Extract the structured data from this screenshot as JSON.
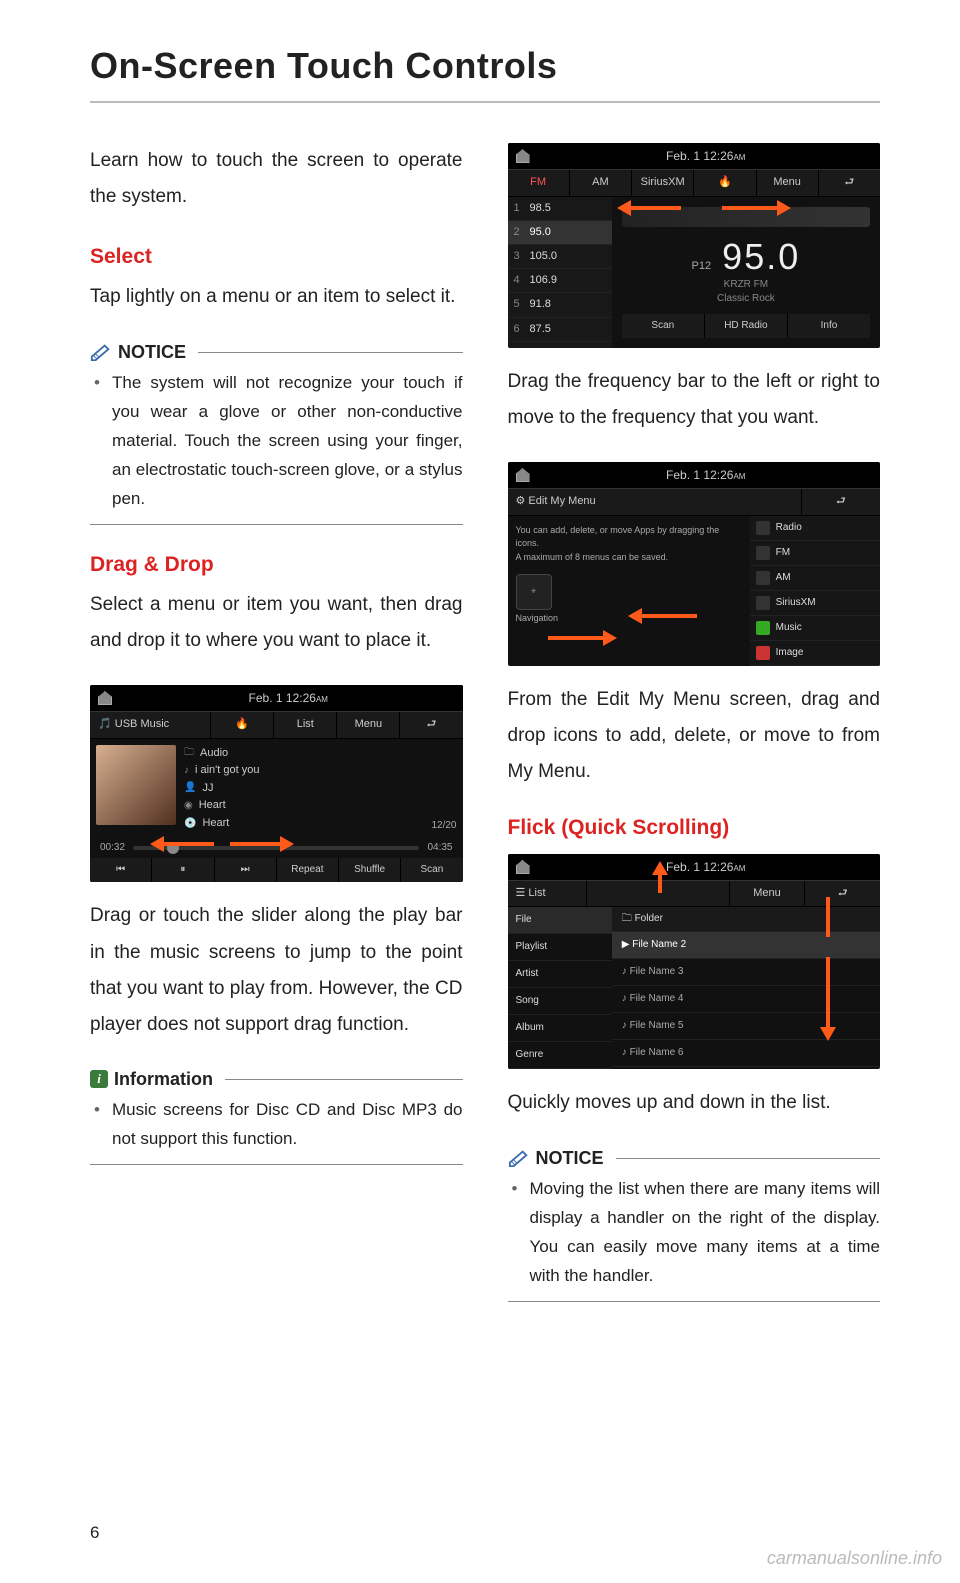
{
  "page": {
    "title": "On-Screen Touch Controls",
    "number": "6",
    "watermark": "carmanualsonline.info"
  },
  "left": {
    "intro": "Learn how to touch the screen to operate the system.",
    "select": {
      "heading": "Select",
      "body": "Tap lightly on a menu or an item to select it."
    },
    "notice1": {
      "label": "NOTICE",
      "body": "The system will not recognize your touch if you wear a glove or other non-conductive material. Touch the screen using your finger, an electrostatic touch-screen glove, or a stylus pen."
    },
    "dragdrop": {
      "heading": "Drag & Drop",
      "body": "Select a menu or item you want, then drag and drop it to where you want to place it."
    },
    "usb_shot": {
      "time": "Feb. 1   12:26",
      "time_suffix": "AM",
      "source": "USB Music",
      "list_btn": "List",
      "menu_btn": "Menu",
      "folder": "Audio",
      "track": "i ain't got you",
      "artist": "JJ",
      "album1": "Heart",
      "album2": "Heart",
      "counter": "12/20",
      "t_cur": "00:32",
      "t_tot": "04:35",
      "foot": [
        "⏮",
        "⏸",
        "⏭",
        "Repeat",
        "Shuffle",
        "Scan"
      ]
    },
    "dragdrop_caption": "Drag or touch the slider along the play bar in the music screens to jump to the point that you want to play from. However, the CD player does not support drag function.",
    "information": {
      "label": "Information",
      "body": "Music screens for Disc CD and Disc MP3 do not support this function."
    }
  },
  "right": {
    "radio_shot": {
      "time": "Feb. 1   12:26",
      "time_suffix": "AM",
      "tabs": [
        "FM",
        "AM",
        "SiriusXM"
      ],
      "menu_btn": "Menu",
      "presets": [
        {
          "n": "1",
          "v": "98.5"
        },
        {
          "n": "2",
          "v": "95.0"
        },
        {
          "n": "3",
          "v": "105.0"
        },
        {
          "n": "4",
          "v": "106.9"
        },
        {
          "n": "5",
          "v": "91.8"
        },
        {
          "n": "6",
          "v": "87.5"
        }
      ],
      "preset_label": "P12",
      "big_freq": "95.0",
      "station": "KRZR FM",
      "genre": "Classic Rock",
      "foot": [
        "Scan",
        "HD Radio",
        "Info"
      ]
    },
    "radio_caption": "Drag the frequency bar to the left or right to move to the frequency that you want.",
    "editmenu_shot": {
      "time": "Feb. 1   12:26",
      "time_suffix": "AM",
      "title": "Edit My Menu",
      "hint1": "You can add, delete, or move Apps by dragging the icons.",
      "hint2": "A maximum of 8 menus can be saved.",
      "nav": "Navigation",
      "items": [
        "Radio",
        "FM",
        "AM",
        "SiriusXM",
        "Music",
        "Image"
      ]
    },
    "editmenu_caption": "From the Edit My Menu screen, drag and drop icons to add, delete, or move to from My Menu.",
    "flick": {
      "heading": "Flick (Quick Scrolling)"
    },
    "list_shot": {
      "time": "Feb. 1   12:26",
      "time_suffix": "AM",
      "list_btn": "List",
      "menu_btn": "Menu",
      "left_items": [
        "File",
        "Playlist",
        "Artist",
        "Song",
        "Album",
        "Genre"
      ],
      "folder": "Folder",
      "right_items": [
        "File Name 2",
        "File Name 3",
        "File Name 4",
        "File Name 5",
        "File Name 6"
      ]
    },
    "flick_caption": "Quickly moves up and down in the list.",
    "notice2": {
      "label": "NOTICE",
      "body": "Moving the list when there are many items will display a handler on the right of the display. You can easily move many items at a time with the handler."
    }
  }
}
